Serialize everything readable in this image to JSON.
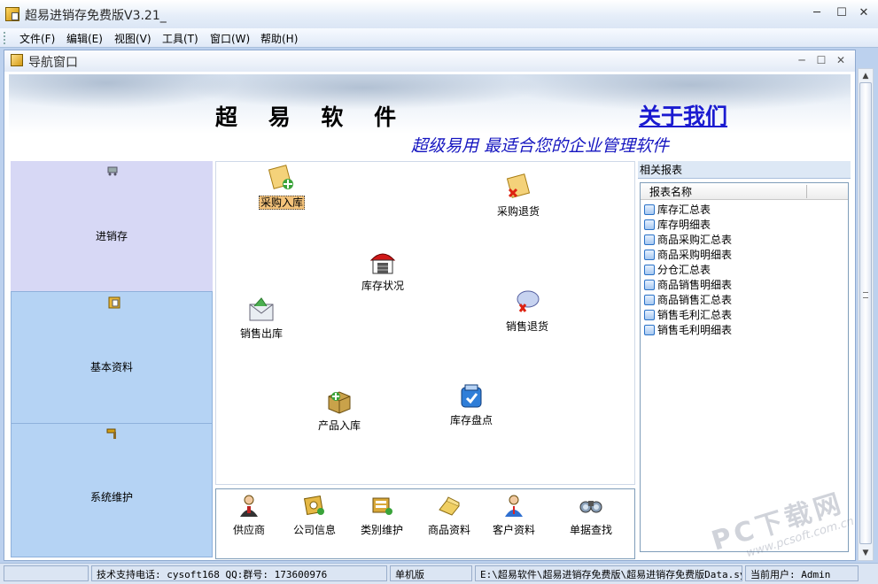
{
  "window": {
    "title": "超易进销存免费版V3.21_",
    "minimize": "─",
    "maximize": "☐",
    "close": "✕"
  },
  "menu": [
    "文件(F)",
    "编辑(E)",
    "视图(V)",
    "工具(T)",
    "窗口(W)",
    "帮助(H)"
  ],
  "child_window": {
    "title": "导航窗口"
  },
  "banner": {
    "title": "超 易 软 件",
    "about": "关于我们",
    "slogan": "超级易用  最适合您的企业管理软件"
  },
  "nav_sections": [
    {
      "label": "进销存",
      "icon": "cart-icon",
      "selected": true
    },
    {
      "label": "基本资料",
      "icon": "folder-icon",
      "selected": false
    },
    {
      "label": "系统维护",
      "icon": "hammer-icon",
      "selected": false
    }
  ],
  "functions": [
    {
      "label": "采购入库",
      "icon": "purchase-in-icon",
      "selected": true
    },
    {
      "label": "采购退货",
      "icon": "purchase-return-icon"
    },
    {
      "label": "库存状况",
      "icon": "warehouse-icon"
    },
    {
      "label": "销售出库",
      "icon": "sales-out-icon"
    },
    {
      "label": "销售退货",
      "icon": "sales-return-icon"
    },
    {
      "label": "产品入库",
      "icon": "product-in-icon"
    },
    {
      "label": "库存盘点",
      "icon": "stocktake-icon"
    }
  ],
  "toolbar": [
    {
      "label": "供应商",
      "icon": "supplier-icon"
    },
    {
      "label": "公司信息",
      "icon": "company-info-icon"
    },
    {
      "label": "类别维护",
      "icon": "category-icon"
    },
    {
      "label": "商品资料",
      "icon": "goods-icon"
    },
    {
      "label": "客户资料",
      "icon": "customer-icon"
    },
    {
      "label": "单据查找",
      "icon": "binoculars-icon"
    }
  ],
  "reports": {
    "header": "相关报表",
    "column": "报表名称",
    "items": [
      "库存汇总表",
      "库存明细表",
      "商品采购汇总表",
      "商品采购明细表",
      "分仓汇总表",
      "商品销售明细表",
      "商品销售汇总表",
      "销售毛利汇总表",
      "销售毛利明细表"
    ]
  },
  "status": {
    "support": "技术支持电话: cysoft168 QQ:群号: 173600976",
    "mode": "单机版",
    "path": "E:\\超易软件\\超易进销存免费版\\超易进销存免费版Data.sys",
    "user": "当前用户: Admin"
  },
  "watermark": {
    "main": "PC下载网",
    "sub": "www.pcsoft.com.cn"
  },
  "colors": {
    "nav_selected": "#d7d8f5",
    "nav_bg": "#b5d3f4",
    "link": "#1a1ad0",
    "selected_label_bg": "#f3c27a"
  }
}
